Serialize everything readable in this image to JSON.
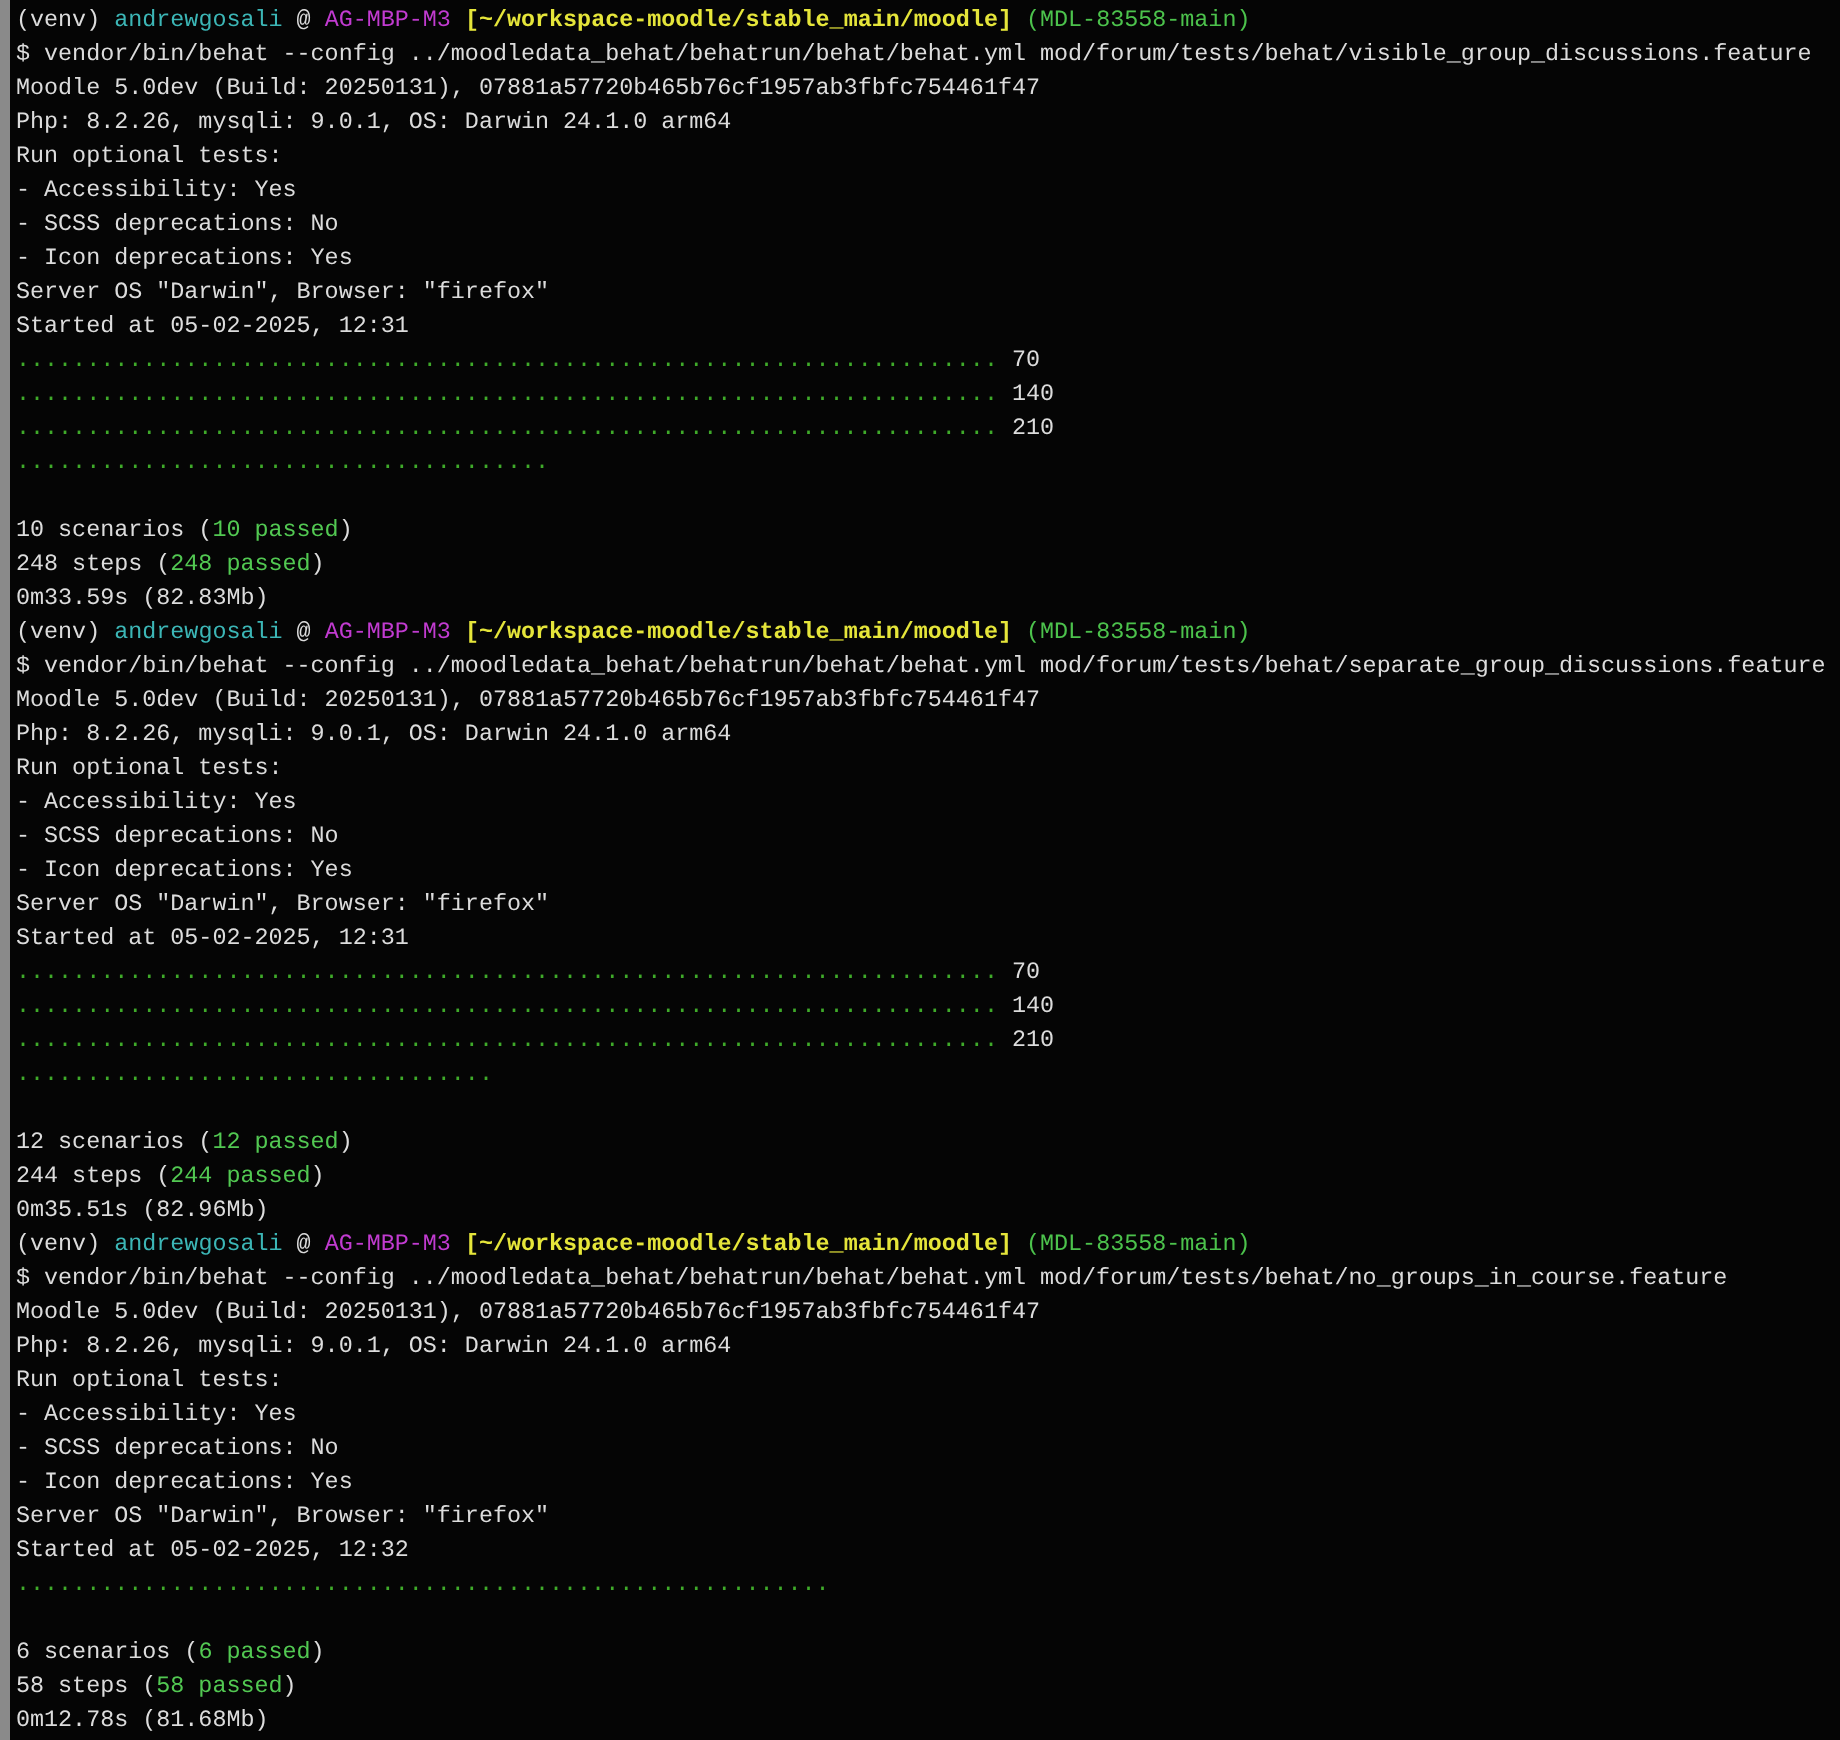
{
  "terminal": {
    "lines": [
      {
        "kind": "prompt",
        "parts": [
          {
            "kind": "plain",
            "text": "(venv) "
          },
          {
            "kind": "user",
            "text": "andrewgosali"
          },
          {
            "kind": "plain",
            "text": " @ "
          },
          {
            "kind": "host",
            "text": "AG-MBP-M3"
          },
          {
            "kind": "path",
            "text": "[~/workspace-moodle/stable_main/moodle]"
          },
          {
            "kind": "branch",
            "text": "(MDL-83558-main)"
          }
        ]
      },
      {
        "kind": "text",
        "text": "$ vendor/bin/behat --config ../moodledata_behat/behatrun/behat/behat.yml mod/forum/tests/behat/visible_group_discussions.feature"
      },
      {
        "kind": "text",
        "text": "Moodle 5.0dev (Build: 20250131), 07881a57720b465b76cf1957ab3fbfc754461f47"
      },
      {
        "kind": "text",
        "text": "Php: 8.2.26, mysqli: 9.0.1, OS: Darwin 24.1.0 arm64"
      },
      {
        "kind": "text",
        "text": "Run optional tests:"
      },
      {
        "kind": "text",
        "text": "- Accessibility: Yes"
      },
      {
        "kind": "text",
        "text": "- SCSS deprecations: No"
      },
      {
        "kind": "text",
        "text": "- Icon deprecations: Yes"
      },
      {
        "kind": "text",
        "text": "Server OS \"Darwin\", Browser: \"firefox\""
      },
      {
        "kind": "text",
        "text": "Started at 05-02-2025, 12:31"
      },
      {
        "kind": "progress",
        "parts": [
          {
            "kind": "dots",
            "text": "......................................................................"
          },
          {
            "kind": "plain",
            "text": " 70"
          }
        ]
      },
      {
        "kind": "progress",
        "parts": [
          {
            "kind": "dots",
            "text": "......................................................................"
          },
          {
            "kind": "plain",
            "text": " 140"
          }
        ]
      },
      {
        "kind": "progress",
        "parts": [
          {
            "kind": "dots",
            "text": "......................................................................"
          },
          {
            "kind": "plain",
            "text": " 210"
          }
        ]
      },
      {
        "kind": "progress",
        "parts": [
          {
            "kind": "dots",
            "text": "......................................"
          }
        ]
      },
      {
        "kind": "blank"
      },
      {
        "kind": "summary",
        "parts": [
          {
            "kind": "plain",
            "text": "10 scenarios ("
          },
          {
            "kind": "pass",
            "text": "10 passed"
          },
          {
            "kind": "plain",
            "text": ")"
          }
        ]
      },
      {
        "kind": "summary",
        "parts": [
          {
            "kind": "plain",
            "text": "248 steps ("
          },
          {
            "kind": "pass",
            "text": "248 passed"
          },
          {
            "kind": "plain",
            "text": ")"
          }
        ]
      },
      {
        "kind": "text",
        "text": "0m33.59s (82.83Mb)"
      },
      {
        "kind": "prompt",
        "parts": [
          {
            "kind": "plain",
            "text": "(venv) "
          },
          {
            "kind": "user",
            "text": "andrewgosali"
          },
          {
            "kind": "plain",
            "text": " @ "
          },
          {
            "kind": "host",
            "text": "AG-MBP-M3"
          },
          {
            "kind": "path",
            "text": "[~/workspace-moodle/stable_main/moodle]"
          },
          {
            "kind": "branch",
            "text": "(MDL-83558-main)"
          }
        ]
      },
      {
        "kind": "text",
        "text": "$ vendor/bin/behat --config ../moodledata_behat/behatrun/behat/behat.yml mod/forum/tests/behat/separate_group_discussions.feature"
      },
      {
        "kind": "text",
        "text": "Moodle 5.0dev (Build: 20250131), 07881a57720b465b76cf1957ab3fbfc754461f47"
      },
      {
        "kind": "text",
        "text": "Php: 8.2.26, mysqli: 9.0.1, OS: Darwin 24.1.0 arm64"
      },
      {
        "kind": "text",
        "text": "Run optional tests:"
      },
      {
        "kind": "text",
        "text": "- Accessibility: Yes"
      },
      {
        "kind": "text",
        "text": "- SCSS deprecations: No"
      },
      {
        "kind": "text",
        "text": "- Icon deprecations: Yes"
      },
      {
        "kind": "text",
        "text": "Server OS \"Darwin\", Browser: \"firefox\""
      },
      {
        "kind": "text",
        "text": "Started at 05-02-2025, 12:31"
      },
      {
        "kind": "progress",
        "parts": [
          {
            "kind": "dots",
            "text": "......................................................................"
          },
          {
            "kind": "plain",
            "text": " 70"
          }
        ]
      },
      {
        "kind": "progress",
        "parts": [
          {
            "kind": "dots",
            "text": "......................................................................"
          },
          {
            "kind": "plain",
            "text": " 140"
          }
        ]
      },
      {
        "kind": "progress",
        "parts": [
          {
            "kind": "dots",
            "text": "......................................................................"
          },
          {
            "kind": "plain",
            "text": " 210"
          }
        ]
      },
      {
        "kind": "progress",
        "parts": [
          {
            "kind": "dots",
            "text": ".................................."
          }
        ]
      },
      {
        "kind": "blank"
      },
      {
        "kind": "summary",
        "parts": [
          {
            "kind": "plain",
            "text": "12 scenarios ("
          },
          {
            "kind": "pass",
            "text": "12 passed"
          },
          {
            "kind": "plain",
            "text": ")"
          }
        ]
      },
      {
        "kind": "summary",
        "parts": [
          {
            "kind": "plain",
            "text": "244 steps ("
          },
          {
            "kind": "pass",
            "text": "244 passed"
          },
          {
            "kind": "plain",
            "text": ")"
          }
        ]
      },
      {
        "kind": "text",
        "text": "0m35.51s (82.96Mb)"
      },
      {
        "kind": "prompt",
        "parts": [
          {
            "kind": "plain",
            "text": "(venv) "
          },
          {
            "kind": "user",
            "text": "andrewgosali"
          },
          {
            "kind": "plain",
            "text": " @ "
          },
          {
            "kind": "host",
            "text": "AG-MBP-M3"
          },
          {
            "kind": "path",
            "text": "[~/workspace-moodle/stable_main/moodle]"
          },
          {
            "kind": "branch",
            "text": "(MDL-83558-main)"
          }
        ]
      },
      {
        "kind": "text",
        "text": "$ vendor/bin/behat --config ../moodledata_behat/behatrun/behat/behat.yml mod/forum/tests/behat/no_groups_in_course.feature"
      },
      {
        "kind": "text",
        "text": "Moodle 5.0dev (Build: 20250131), 07881a57720b465b76cf1957ab3fbfc754461f47"
      },
      {
        "kind": "text",
        "text": "Php: 8.2.26, mysqli: 9.0.1, OS: Darwin 24.1.0 arm64"
      },
      {
        "kind": "text",
        "text": "Run optional tests:"
      },
      {
        "kind": "text",
        "text": "- Accessibility: Yes"
      },
      {
        "kind": "text",
        "text": "- SCSS deprecations: No"
      },
      {
        "kind": "text",
        "text": "- Icon deprecations: Yes"
      },
      {
        "kind": "text",
        "text": "Server OS \"Darwin\", Browser: \"firefox\""
      },
      {
        "kind": "text",
        "text": "Started at 05-02-2025, 12:32"
      },
      {
        "kind": "progress",
        "parts": [
          {
            "kind": "dots",
            "text": ".........................................................."
          }
        ]
      },
      {
        "kind": "blank"
      },
      {
        "kind": "summary",
        "parts": [
          {
            "kind": "plain",
            "text": "6 scenarios ("
          },
          {
            "kind": "pass",
            "text": "6 passed"
          },
          {
            "kind": "plain",
            "text": ")"
          }
        ]
      },
      {
        "kind": "summary",
        "parts": [
          {
            "kind": "plain",
            "text": "58 steps ("
          },
          {
            "kind": "pass",
            "text": "58 passed"
          },
          {
            "kind": "plain",
            "text": ")"
          }
        ]
      },
      {
        "kind": "text",
        "text": "0m12.78s (81.68Mb)"
      }
    ]
  }
}
